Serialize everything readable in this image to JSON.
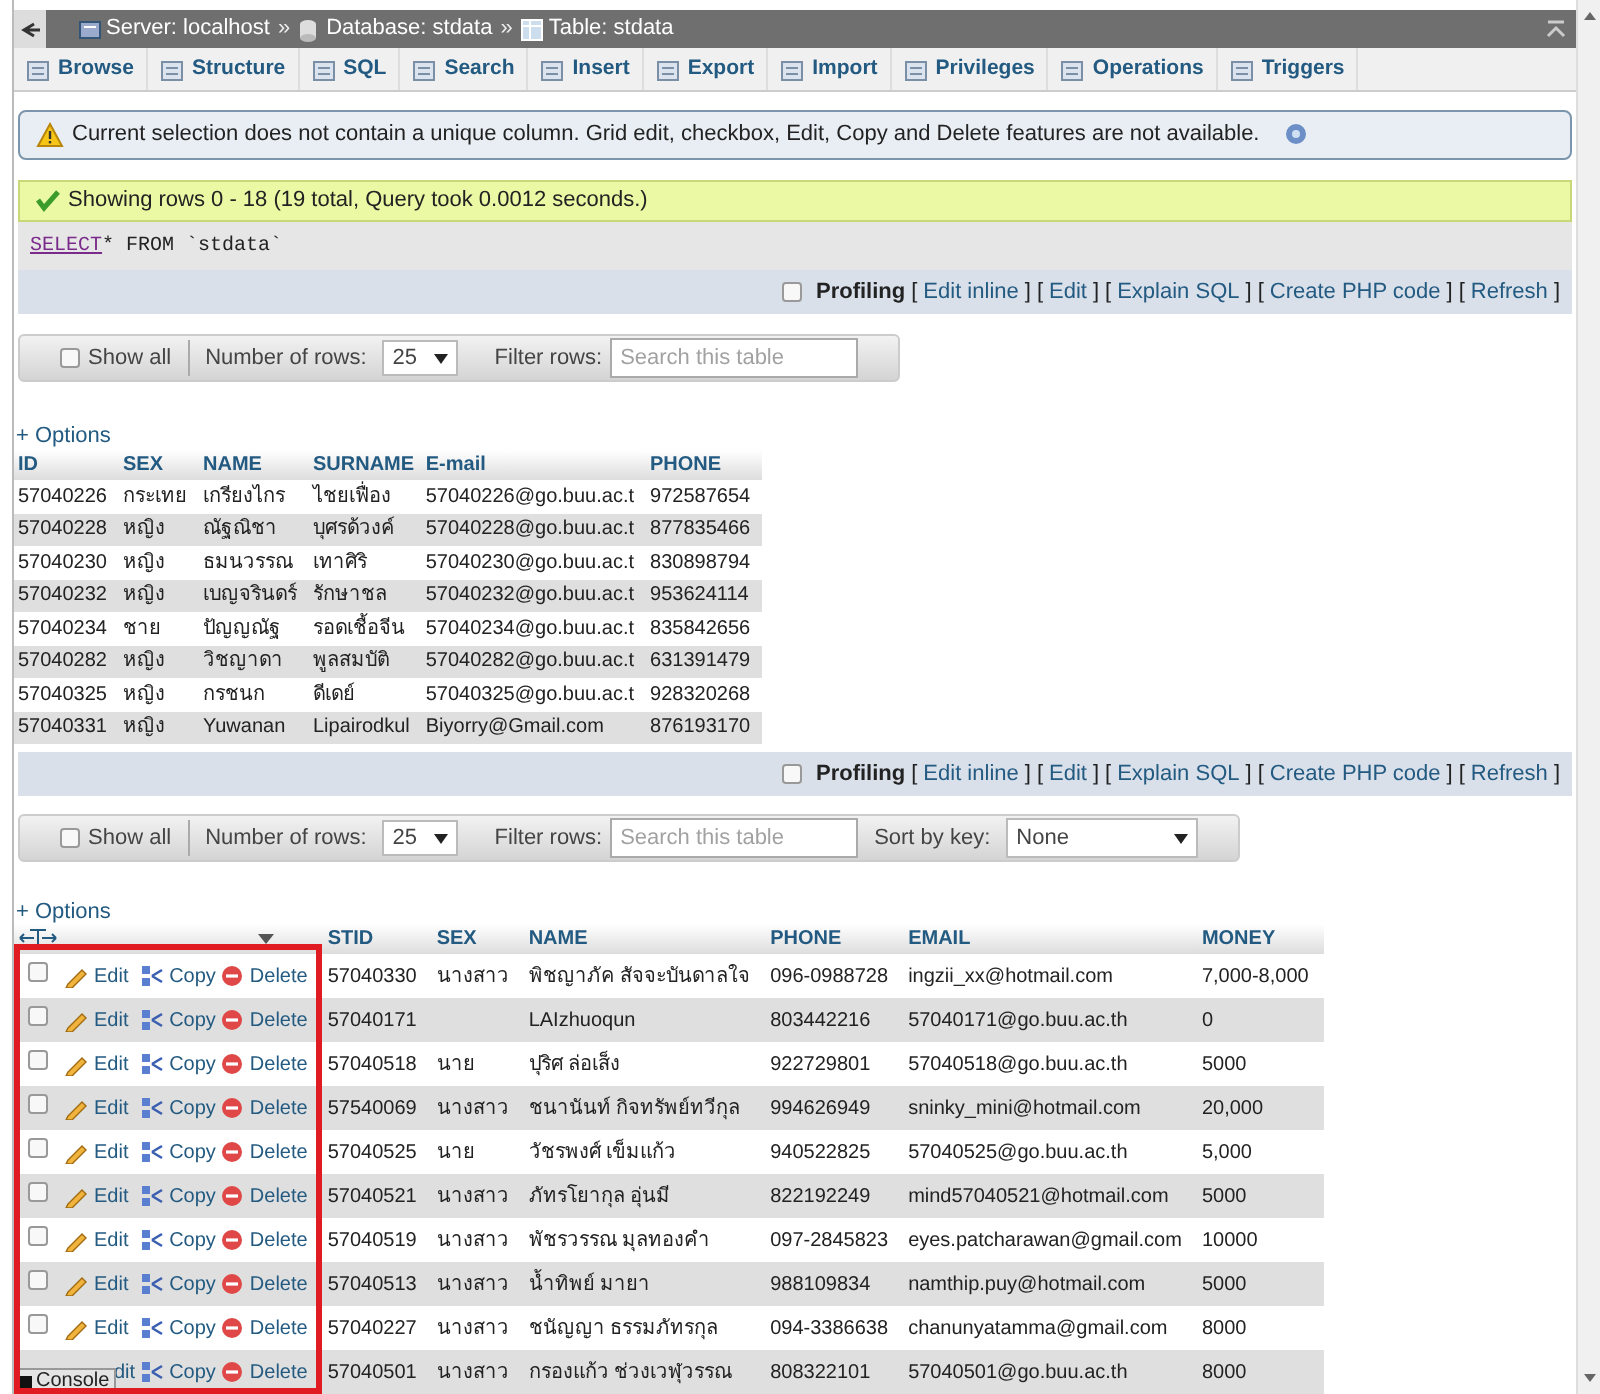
{
  "breadcrumb": [
    {
      "kind": "server",
      "label": "Server: localhost"
    },
    {
      "kind": "separator",
      "label": "»"
    },
    {
      "kind": "database",
      "label": "Database: stdata"
    },
    {
      "kind": "separator",
      "label": "»"
    },
    {
      "kind": "table",
      "label": "Table: stdata"
    }
  ],
  "tabs": [
    "Browse",
    "Structure",
    "SQL",
    "Search",
    "Insert",
    "Export",
    "Import",
    "Privileges",
    "Operations",
    "Triggers"
  ],
  "warning": "Current selection does not contain a unique column. Grid edit, checkbox, Edit, Copy and Delete features are not available.",
  "success": "Showing rows 0 - 18 (19 total, Query took 0.0012 seconds.)",
  "sql": {
    "keyword": "SELECT",
    "rest": " * FROM `stdata`"
  },
  "profiling": [
    {
      "checked": false,
      "label": "Profiling",
      "links": [
        {
          "kind": "bracket",
          "text": "["
        },
        {
          "kind": "link",
          "text": "Edit inline"
        },
        {
          "kind": "bracket",
          "text": "]"
        },
        {
          "kind": "bracket",
          "text": "["
        },
        {
          "kind": "link",
          "text": "Edit"
        },
        {
          "kind": "bracket",
          "text": "]"
        },
        {
          "kind": "bracket",
          "text": "["
        },
        {
          "kind": "link",
          "text": "Explain SQL"
        },
        {
          "kind": "bracket",
          "text": "]"
        },
        {
          "kind": "bracket",
          "text": "["
        },
        {
          "kind": "link",
          "text": "Create PHP code"
        },
        {
          "kind": "bracket",
          "text": "]"
        },
        {
          "kind": "bracket",
          "text": "["
        },
        {
          "kind": "link",
          "text": "Refresh"
        },
        {
          "kind": "bracket",
          "text": "]"
        }
      ]
    },
    {
      "checked": false,
      "label": "Profiling",
      "links": [
        {
          "kind": "bracket",
          "text": "["
        },
        {
          "kind": "link",
          "text": "Edit inline"
        },
        {
          "kind": "bracket",
          "text": "]"
        },
        {
          "kind": "bracket",
          "text": "["
        },
        {
          "kind": "link",
          "text": "Edit"
        },
        {
          "kind": "bracket",
          "text": "]"
        },
        {
          "kind": "bracket",
          "text": "["
        },
        {
          "kind": "link",
          "text": "Explain SQL"
        },
        {
          "kind": "bracket",
          "text": "]"
        },
        {
          "kind": "bracket",
          "text": "["
        },
        {
          "kind": "link",
          "text": "Create PHP code"
        },
        {
          "kind": "bracket",
          "text": "]"
        },
        {
          "kind": "bracket",
          "text": "["
        },
        {
          "kind": "link",
          "text": "Refresh"
        },
        {
          "kind": "bracket",
          "text": "]"
        }
      ]
    }
  ],
  "navs": [
    {
      "show_all": {
        "label": "Show all",
        "checked": false
      },
      "rows_label": "Number of rows:",
      "rows_value": "25",
      "filter_label": "Filter rows:",
      "filter_placeholder": "Search this table"
    },
    {
      "show_all": {
        "label": "Show all",
        "checked": false
      },
      "rows_label": "Number of rows:",
      "rows_value": "25",
      "filter_label": "Filter rows:",
      "filter_placeholder": "Search this table",
      "sort_label": "Sort by key:",
      "sort_value": "None"
    }
  ],
  "table1": {
    "options": "+ Options",
    "columns": [
      "ID",
      "SEX",
      "NAME",
      "SURNAME",
      "E-mail",
      "PHONE"
    ],
    "rows": [
      [
        "57040226",
        "กระเทย",
        "เกรียงไกร",
        "ไชยเฟื่อง",
        "57040226@go.buu.ac.t",
        "972587654"
      ],
      [
        "57040228",
        "หญิง",
        "ณัฐณิชา",
        "บุศรด้วงค์",
        "57040228@go.buu.ac.t",
        "877835466"
      ],
      [
        "57040230",
        "หญิง",
        "ธมนวรรณ",
        "เทาศิริ",
        "57040230@go.buu.ac.t",
        "830898794"
      ],
      [
        "57040232",
        "หญิง",
        "เบญจรินดร์",
        "รักษาชล",
        "57040232@go.buu.ac.t",
        "953624114"
      ],
      [
        "57040234",
        "ชาย",
        "ปัญญณัฐ",
        "รอดเชื้อจีน",
        "57040234@go.buu.ac.t",
        "835842656"
      ],
      [
        "57040282",
        "หญิง",
        "วิชญาดา",
        "พูลสมบัติ",
        "57040282@go.buu.ac.t",
        "631391479"
      ],
      [
        "57040325",
        "หญิง",
        "กรชนก",
        "ดีเดย์",
        "57040325@go.buu.ac.t",
        "928320268"
      ],
      [
        "57040331",
        "หญิง",
        "Yuwanan",
        "Lipairodkul",
        "Biyorry@Gmail.com",
        "876193170"
      ]
    ]
  },
  "table2": {
    "options": "+ Options",
    "columns": [
      "STID",
      "SEX",
      "NAME",
      "PHONE",
      "EMAIL",
      "MONEY"
    ],
    "rows": [
      {
        "checked": false,
        "actions": [
          {
            "kind": "edit",
            "label": "Edit"
          },
          {
            "kind": "copy",
            "label": "Copy"
          },
          {
            "kind": "delete",
            "label": "Delete"
          }
        ],
        "cells": [
          "57040330",
          "นางสาว",
          "พิชญาภัค สัจจะบันดาลใจ",
          "096-0988728",
          "ingzii_xx@hotmail.com",
          "7,000-8,000"
        ]
      },
      {
        "checked": false,
        "actions": [
          {
            "kind": "edit",
            "label": "Edit"
          },
          {
            "kind": "copy",
            "label": "Copy"
          },
          {
            "kind": "delete",
            "label": "Delete"
          }
        ],
        "cells": [
          "57040171",
          "",
          "LAIzhuoqun",
          "803442216",
          "57040171@go.buu.ac.th",
          "0"
        ]
      },
      {
        "checked": false,
        "actions": [
          {
            "kind": "edit",
            "label": "Edit"
          },
          {
            "kind": "copy",
            "label": "Copy"
          },
          {
            "kind": "delete",
            "label": "Delete"
          }
        ],
        "cells": [
          "57040518",
          "นาย",
          "ปุริศ ล่อเส็ง",
          "922729801",
          "57040518@go.buu.ac.th",
          "5000"
        ]
      },
      {
        "checked": false,
        "actions": [
          {
            "kind": "edit",
            "label": "Edit"
          },
          {
            "kind": "copy",
            "label": "Copy"
          },
          {
            "kind": "delete",
            "label": "Delete"
          }
        ],
        "cells": [
          "57540069",
          "นางสาว",
          "ชนานันท์ กิจทรัพย์ทวีกุล",
          "994626949",
          "sninky_mini@hotmail.com",
          "20,000"
        ]
      },
      {
        "checked": false,
        "actions": [
          {
            "kind": "edit",
            "label": "Edit"
          },
          {
            "kind": "copy",
            "label": "Copy"
          },
          {
            "kind": "delete",
            "label": "Delete"
          }
        ],
        "cells": [
          "57040525",
          "นาย",
          "วัชรพงศ์ เข็มแก้ว",
          "940522825",
          "57040525@go.buu.ac.th",
          "5,000"
        ]
      },
      {
        "checked": false,
        "actions": [
          {
            "kind": "edit",
            "label": "Edit"
          },
          {
            "kind": "copy",
            "label": "Copy"
          },
          {
            "kind": "delete",
            "label": "Delete"
          }
        ],
        "cells": [
          "57040521",
          "นางสาว",
          "ภัทรโยากุล อุ่นมี",
          "822192249",
          "mind57040521@hotmail.com",
          "5000"
        ]
      },
      {
        "checked": false,
        "actions": [
          {
            "kind": "edit",
            "label": "Edit"
          },
          {
            "kind": "copy",
            "label": "Copy"
          },
          {
            "kind": "delete",
            "label": "Delete"
          }
        ],
        "cells": [
          "57040519",
          "นางสาว",
          "พัชรวรรณ มุลทองคำ",
          "097-2845823",
          "eyes.patcharawan@gmail.com",
          "10000"
        ]
      },
      {
        "checked": false,
        "actions": [
          {
            "kind": "edit",
            "label": "Edit"
          },
          {
            "kind": "copy",
            "label": "Copy"
          },
          {
            "kind": "delete",
            "label": "Delete"
          }
        ],
        "cells": [
          "57040513",
          "นางสาว",
          "น้ำทิพย์ มายา",
          "988109834",
          "namthip.puy@hotmail.com",
          "5000"
        ]
      },
      {
        "checked": false,
        "actions": [
          {
            "kind": "edit",
            "label": "Edit"
          },
          {
            "kind": "copy",
            "label": "Copy"
          },
          {
            "kind": "delete",
            "label": "Delete"
          }
        ],
        "cells": [
          "57040227",
          "นางสาว",
          "ชนัญญา ธรรมภัทรกุล",
          "094-3386638",
          "chanunyatamma@gmail.com",
          "8000"
        ]
      },
      {
        "actions": [
          {
            "kind": "edit_partial",
            "label": "dit"
          },
          {
            "kind": "copy",
            "label": "Copy"
          },
          {
            "kind": "delete",
            "label": "Delete"
          }
        ],
        "cells": [
          "57040501",
          "นางสาว",
          "กรองแก้ว ช่วงเวฬุวรรณ",
          "808322101",
          "57040501@go.buu.ac.th",
          "8000"
        ]
      }
    ]
  },
  "console": "Console"
}
